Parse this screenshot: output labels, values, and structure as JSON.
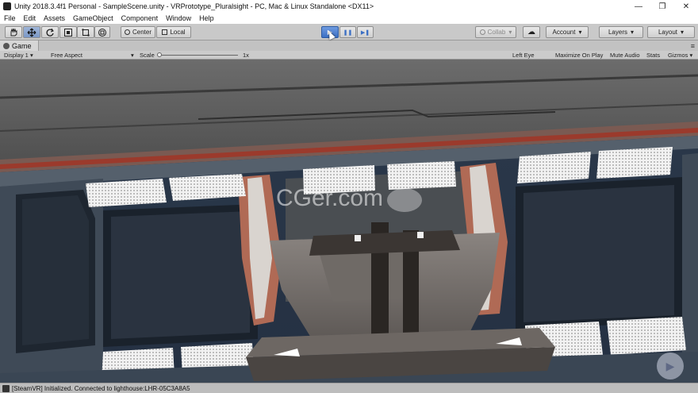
{
  "window": {
    "title": "Unity 2018.3.4f1 Personal - SampleScene.unity - VRPrototype_Pluralsight - PC, Mac & Linux Standalone <DX11>",
    "minimize": "—",
    "maximize": "❐",
    "close": "✕"
  },
  "menu": [
    "File",
    "Edit",
    "Assets",
    "GameObject",
    "Component",
    "Window",
    "Help"
  ],
  "toolbar": {
    "tools": [
      "hand-icon",
      "move-icon",
      "rotate-icon",
      "scale-icon",
      "rect-icon",
      "transform-icon"
    ],
    "pivot": "Center",
    "space": "Local",
    "play": "▶",
    "pause": "❚❚",
    "step": "▶❚",
    "collab": "Collab",
    "cloud": "☁",
    "account": "Account",
    "layers": "Layers",
    "layout": "Layout"
  },
  "game_tab": {
    "label": "Game",
    "menu": "≡"
  },
  "game_bar": {
    "display": "Display 1",
    "aspect": "Free Aspect",
    "scale_label": "Scale",
    "scale_value": "1x",
    "eye": "Left Eye",
    "maximize_on_play": "Maximize On Play",
    "mute_audio": "Mute Audio",
    "stats": "Stats",
    "gizmos": "Gizmos"
  },
  "viewport": {
    "watermark": "CGer.com"
  },
  "status": {
    "message": "[SteamVR] Initialized. Connected to lighthouse:LHR-05C3A8A5"
  }
}
